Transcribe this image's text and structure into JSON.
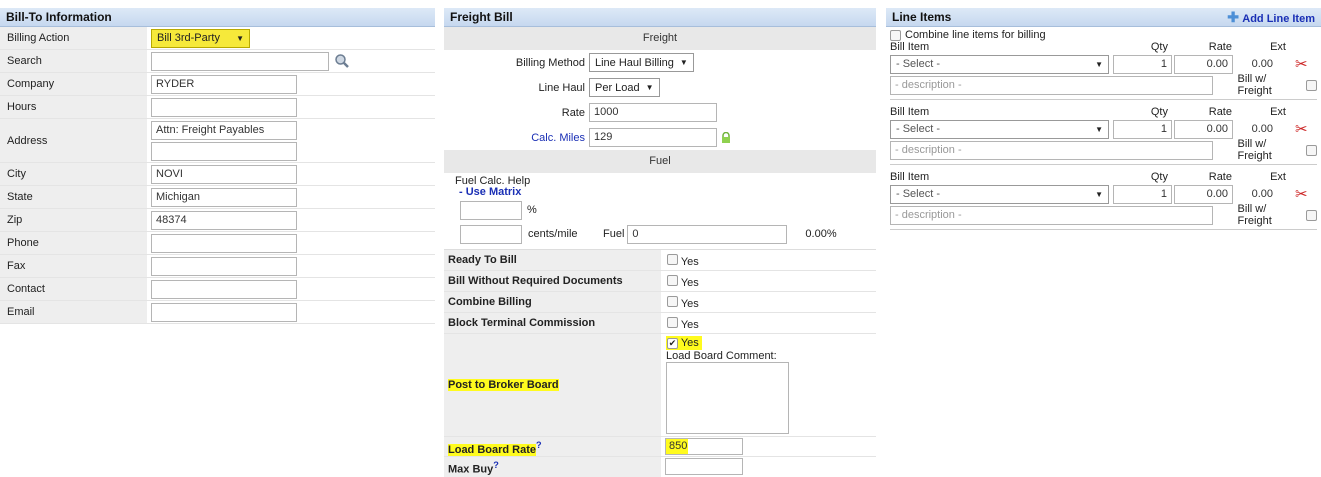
{
  "billto": {
    "title": "Bill-To Information",
    "rows": [
      {
        "label": "Billing Action",
        "value": "Bill 3rd-Party"
      },
      {
        "label": "Search",
        "value": ""
      },
      {
        "label": "Company",
        "value": "RYDER"
      },
      {
        "label": "Hours",
        "value": ""
      },
      {
        "label": "Address",
        "value1": "Attn: Freight Payables",
        "value2": ""
      },
      {
        "label": "City",
        "value": "NOVI"
      },
      {
        "label": "State",
        "value": "Michigan"
      },
      {
        "label": "Zip",
        "value": "48374"
      },
      {
        "label": "Phone",
        "value": ""
      },
      {
        "label": "Fax",
        "value": ""
      },
      {
        "label": "Contact",
        "value": ""
      },
      {
        "label": "Email",
        "value": ""
      }
    ]
  },
  "freight": {
    "title": "Freight Bill",
    "section_freight": "Freight",
    "billing_method_label": "Billing Method",
    "billing_method_value": "Line Haul Billing",
    "line_haul_label": "Line Haul",
    "line_haul_value": "Per Load",
    "rate_label": "Rate",
    "rate_value": "1000",
    "calc_miles_label": "Calc. Miles",
    "calc_miles_value": "129",
    "section_fuel": "Fuel",
    "fuel_help": "Fuel Calc. Help",
    "use_matrix": "- Use Matrix",
    "percent_symbol": "%",
    "cents_mile": "cents/mile",
    "fuel_label": "Fuel",
    "fuel_value": "0",
    "fuel_pct": "0.00%",
    "yes": "Yes",
    "ready_to_bill": "Ready To Bill",
    "bill_without_docs": "Bill Without Required Documents",
    "combine_billing": "Combine Billing",
    "block_terminal": "Block Terminal Commission",
    "post_broker": "Post to Broker Board",
    "load_board_comment": "Load Board Comment:",
    "load_board_rate": "Load Board Rate",
    "load_board_rate_value": "850",
    "max_buy": "Max Buy",
    "help_mark": "?"
  },
  "lineitems": {
    "title": "Line Items",
    "add_label": "Add Line Item",
    "combine_label": "Combine line items for billing",
    "col_bill_item": "Bill Item",
    "col_qty": "Qty",
    "col_rate": "Rate",
    "col_ext": "Ext",
    "select_placeholder": "- Select -",
    "description_placeholder": "- description -",
    "bill_w_freight": "Bill w/ Freight",
    "items": [
      {
        "qty": "1",
        "rate": "0.00",
        "ext": "0.00"
      },
      {
        "qty": "1",
        "rate": "0.00",
        "ext": "0.00"
      },
      {
        "qty": "1",
        "rate": "0.00",
        "ext": "0.00"
      }
    ]
  }
}
